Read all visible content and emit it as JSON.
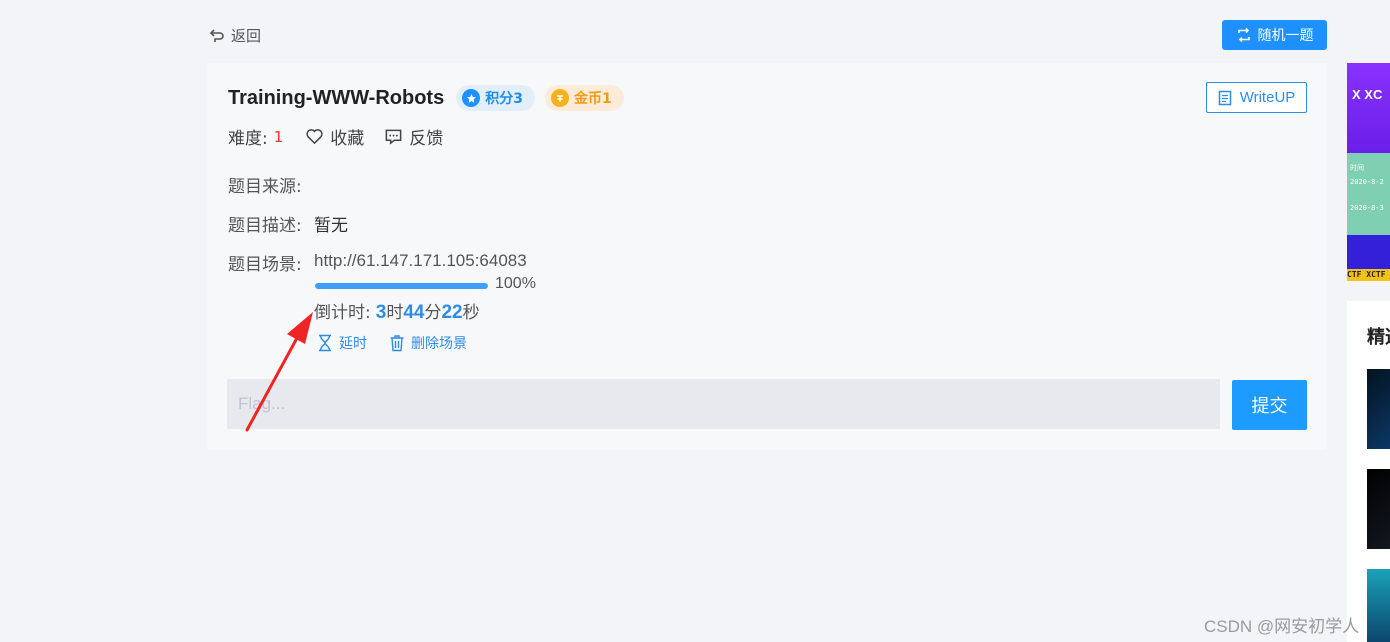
{
  "nav": {
    "back_label": "返回",
    "random_label": "随机一题"
  },
  "challenge": {
    "title": "Training-WWW-Robots",
    "score_badge": "积分3",
    "coin_badge": "金币1",
    "writeup_label": "WriteUP",
    "difficulty_label": "难度:",
    "difficulty_value": "1",
    "favorite_label": "收藏",
    "feedback_label": "反馈",
    "source_label": "题目来源:",
    "source_value": "",
    "desc_label": "题目描述:",
    "desc_value": "暂无",
    "scene_label": "题目场景:",
    "scene_url": "http://61.147.171.105:64083",
    "progress_percent": 100,
    "progress_text": "100%",
    "countdown": {
      "label": "倒计时:",
      "hours": "3",
      "hours_unit": "时",
      "minutes": "44",
      "minutes_unit": "分",
      "seconds": "22",
      "seconds_unit": "秒"
    },
    "extend_label": "延时",
    "delete_label": "删除场景",
    "flag_placeholder": "Flag...",
    "submit_label": "提交"
  },
  "side": {
    "banner_logo": "X XC",
    "banner_line1": "时间",
    "banner_line2": "2020-8-2",
    "banner_line3": "2020-8-3",
    "banner_footer": "CTF XCTF",
    "panel_title": "精选"
  },
  "watermark": "CSDN @网安初学人",
  "colors": {
    "accent": "#1e90ff",
    "coin": "#f09c12",
    "difficulty": "#e33333",
    "page_bg": "#f3f4f7"
  }
}
